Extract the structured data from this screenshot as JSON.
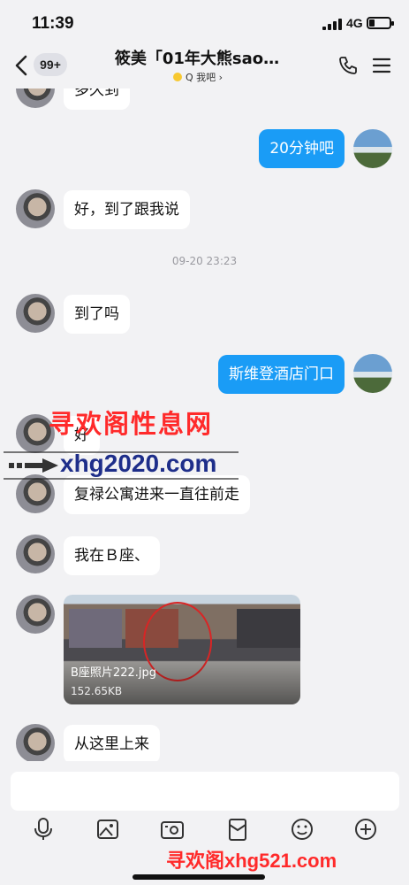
{
  "status_bar": {
    "time": "11:39",
    "network": "4G",
    "battery_level": 0.25,
    "icons": [
      "signal-icon",
      "battery-icon"
    ]
  },
  "header": {
    "unread_badge": "99+",
    "title": "筱美「01年大熊sao…",
    "subtitle": "Q 我吧",
    "icons": [
      "back-icon",
      "phone-icon",
      "menu-icon"
    ]
  },
  "messages": [
    {
      "side": "left",
      "text": "多久到"
    },
    {
      "side": "right",
      "text": "20分钟吧"
    },
    {
      "side": "left",
      "text": "好，到了跟我说"
    },
    {
      "type": "timestamp",
      "text": "09-20 23:23"
    },
    {
      "side": "left",
      "text": "到了吗"
    },
    {
      "side": "right",
      "text": "斯维登酒店门口"
    },
    {
      "side": "left",
      "text": "好"
    },
    {
      "side": "left",
      "text": "复禄公寓进来一直往前走"
    },
    {
      "side": "left",
      "text": "我在Ｂ座、"
    },
    {
      "side": "left",
      "type": "image",
      "file_name": "B座照片222.jpg",
      "file_size": "152.65KB"
    },
    {
      "side": "left",
      "text": "从这里上来"
    }
  ],
  "watermarks": {
    "line1": "寻欢阁性息网",
    "line2": "xhg2020.com",
    "bottom": "寻欢阁xhg521.com"
  },
  "input": {
    "value": "",
    "placeholder": ""
  },
  "toolbar": [
    "microphone-icon",
    "image-icon",
    "camera-icon",
    "red-packet-icon",
    "emoji-icon",
    "plus-icon"
  ],
  "colors": {
    "accent": "#1a9cf6",
    "background": "#f2f2f4",
    "bubble_left": "#ffffff",
    "watermark_red": "#ff2a2a",
    "watermark_blue": "#1e2e8a"
  }
}
